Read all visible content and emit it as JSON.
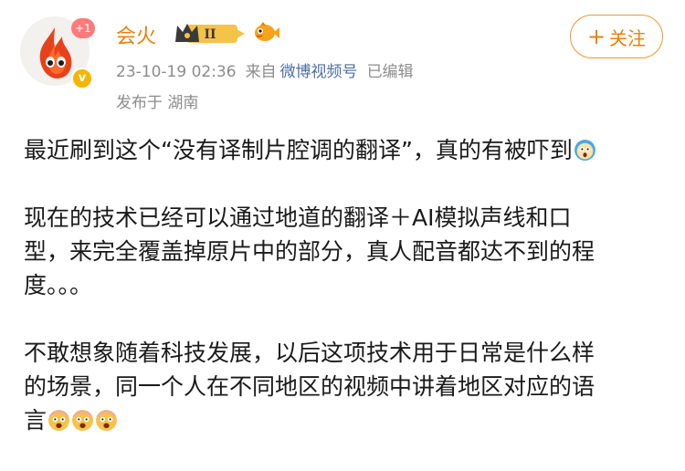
{
  "author": {
    "name": "会火",
    "notification_count": "+1",
    "vip_level": "II",
    "verify_mark": "v"
  },
  "meta": {
    "timestamp": "23-10-19 02:36",
    "source_prefix": "来自",
    "source_name": "微博视频号",
    "edited": "已编辑"
  },
  "location": "发布于 湖南",
  "follow_button": {
    "icon": "+",
    "label": "关注"
  },
  "post": {
    "p1": "最近刷到这个“没有译制片腔调的翻译”，真的有被吓到",
    "p2_l1": "现在的技术已经可以通过地道的翻译＋AI模拟声线和口",
    "p2_l2": "型，来完全覆盖掉原片中的部分，真人配音都达不到的程",
    "p2_l3": "度。。。",
    "p3_l1": "不敢想象随着科技发展，以后这项技术用于日常是什么样",
    "p3_l2": "的场景，同一个人在不同地区的视频中讲着地区对应的语",
    "p3_l3": "言"
  },
  "colors": {
    "username": "#e8800c",
    "source_link": "#4e6ea5",
    "meta": "#8c8c8c",
    "follow_border": "#e89a30"
  },
  "icons": [
    "avatar-flame-icon",
    "vip-crown-icon",
    "fish-icon",
    "shocked-face-icon",
    "scared-face-icon"
  ]
}
